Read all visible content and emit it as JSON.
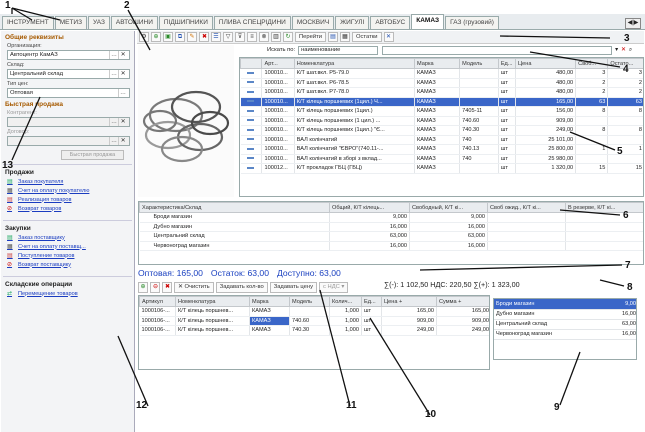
{
  "tabs": [
    "ІНСТРУМЕНТ",
    "МЕТИЗ",
    "УАЗ",
    "АВТОШИНИ",
    "ПІДШИПНИКИ",
    "ПЛИВА СПЕЦРІДИНИ",
    "МОСКВИЧ",
    "ЖИГУЛІ",
    "АВТОБУС",
    "КАМАЗ",
    "ГАЗ (грузовий)"
  ],
  "active_tab": "КАМАЗ",
  "tab_nav": "◀|▶",
  "requisites": {
    "title": "Общие реквизиты",
    "org_label": "Организация:",
    "org_value": "Автоцентр КамАЗ",
    "warehouse_label": "Склад:",
    "warehouse_value": "Центральний склад",
    "price_label": "Тип цен:",
    "price_value": "Оптовая"
  },
  "quick_sale": {
    "title": "Быстрая продажа",
    "contractor_label": "Контрагент:",
    "contract_label": "Договор:",
    "button": "Быстрая продажа"
  },
  "sales": {
    "title": "Продажи",
    "links": [
      "Заказ покупателя",
      "Счет на оплату покупателю",
      "Реализация товаров",
      "Возврат товаров"
    ]
  },
  "purchases": {
    "title": "Закупки",
    "links": [
      "Заказ поставщику",
      "Счет на оплату поставщ...",
      "Поступление товаров",
      "Возврат поставщику"
    ]
  },
  "warehouse_ops": {
    "title": "Складские операции",
    "links": [
      "Перемещение товаров"
    ]
  },
  "toolbar": {
    "goto": "Перейти",
    "stock_btn": "Остатки"
  },
  "search": {
    "label": "Искать по:",
    "field": "наименование"
  },
  "grid": {
    "headers": [
      "",
      "Арт...",
      "Номенклатура",
      "Марка",
      "Модель",
      "Ед...",
      "Цена",
      "Своб...",
      "Остато..."
    ],
    "rows": [
      [
        "100010...",
        "К/Т шат.вкл. Р5-79.0",
        "КАМАЗ",
        "",
        "шт",
        "480,00",
        "3",
        "3"
      ],
      [
        "100010...",
        "К/Т шат.вкл. Р6-78.5",
        "КАМАЗ",
        "",
        "шт",
        "480,00",
        "2",
        "2"
      ],
      [
        "100010...",
        "К/Т шат.вкл. Р7-78.0",
        "КАМАЗ",
        "",
        "шт",
        "480,00",
        "2",
        "2"
      ],
      [
        "100010...",
        "К/Т кілець поршневих (1цил.) Ч...",
        "КАМАЗ",
        "",
        "шт",
        "165,00",
        "63",
        "63"
      ],
      [
        "100010...",
        "К/Т кілець поршневих (1цил.)",
        "КАМАЗ",
        "7405-11",
        "шт",
        "156,00",
        "8",
        "8"
      ],
      [
        "100010...",
        "К/Т кілець поршневих (1 цил.) ...",
        "КАМАЗ",
        "740.60",
        "шт",
        "909,00",
        "",
        ""
      ],
      [
        "100010...",
        "К/Т кілець поршневих (1цил.) \"Є...",
        "КАМАЗ",
        "740.30",
        "шт",
        "249,00",
        "8",
        "8"
      ],
      [
        "100010...",
        "ВАЛ колінчатий",
        "КАМАЗ",
        "740",
        "шт",
        "25 101,00",
        "",
        ""
      ],
      [
        "100010...",
        "ВАЛ колінчатий \"ЄВРО\"(740.11-...",
        "КАМАЗ",
        "740.13",
        "шт",
        "25 800,00",
        "1",
        "1"
      ],
      [
        "100010...",
        "ВАЛ колінчатий в зборі з вклад...",
        "КАМАЗ",
        "740",
        "шт",
        "25 980,00",
        "",
        ""
      ],
      [
        "100012...",
        "К/Т прокладок ГБЦ (ГБЦ)",
        "КАМАЗ",
        "",
        "шт",
        "1 320,00",
        "15",
        "15"
      ]
    ],
    "selected_row": 3
  },
  "stock": {
    "headers": [
      "Характеристика/Склад",
      "Общий, К/Т кілець...",
      "Свободный, К/Т кі...",
      "Своб ожид., К/Т кі...",
      "В резерве, К/Т кі..."
    ],
    "rows": [
      [
        "Броди магазин",
        "9,000",
        "9,000"
      ],
      [
        "Дубно магазин",
        "16,000",
        "16,000"
      ],
      [
        "Центральний склад",
        "63,000",
        "63,000"
      ],
      [
        "Червоноград магазин",
        "16,000",
        "16,000"
      ]
    ]
  },
  "status": {
    "wholesale": "Оптовая: 165,00",
    "remain": "Остаток: 63,00",
    "available": "Доступно: 63,00"
  },
  "totals": "∑(-): 1 102,50 НДС: 220,50 ∑(+): 1 323,00",
  "doc_toolbar": {
    "clear": "Очистить",
    "set_qty": "Задавать кол-во",
    "set_price": "Задавать цену",
    "vat": "с НДС"
  },
  "doc": {
    "headers": [
      "Артикул",
      "Номенклатура",
      "Марка",
      "Модель",
      "Колич...",
      "Ед...",
      "Цена +",
      "Сумма +"
    ],
    "rows": [
      [
        "1000106-...",
        "К/Т кілець поршнев...",
        "КАМАЗ",
        "",
        "1,000",
        "шт",
        "165,00",
        "165,00"
      ],
      [
        "1000106-...",
        "К/Т кілець поршнев...",
        "КАМАЗ",
        "740.60",
        "1,000",
        "шт",
        "909,00",
        "909,00"
      ],
      [
        "1000106-...",
        "К/Т кілець поршнев...",
        "КАМАЗ",
        "740.30",
        "1,000",
        "шт",
        "249,00",
        "249,00"
      ]
    ]
  },
  "warehouses": [
    [
      "Броди магазин",
      "9,00"
    ],
    [
      "Дубно магазин",
      "16,00"
    ],
    [
      "Центральний склад",
      "63,00"
    ],
    [
      "Червоноград магазин",
      "16,00"
    ]
  ],
  "callouts": [
    "1",
    "2",
    "3",
    "4",
    "5",
    "6",
    "7",
    "8",
    "9",
    "10",
    "11",
    "12",
    "13"
  ]
}
